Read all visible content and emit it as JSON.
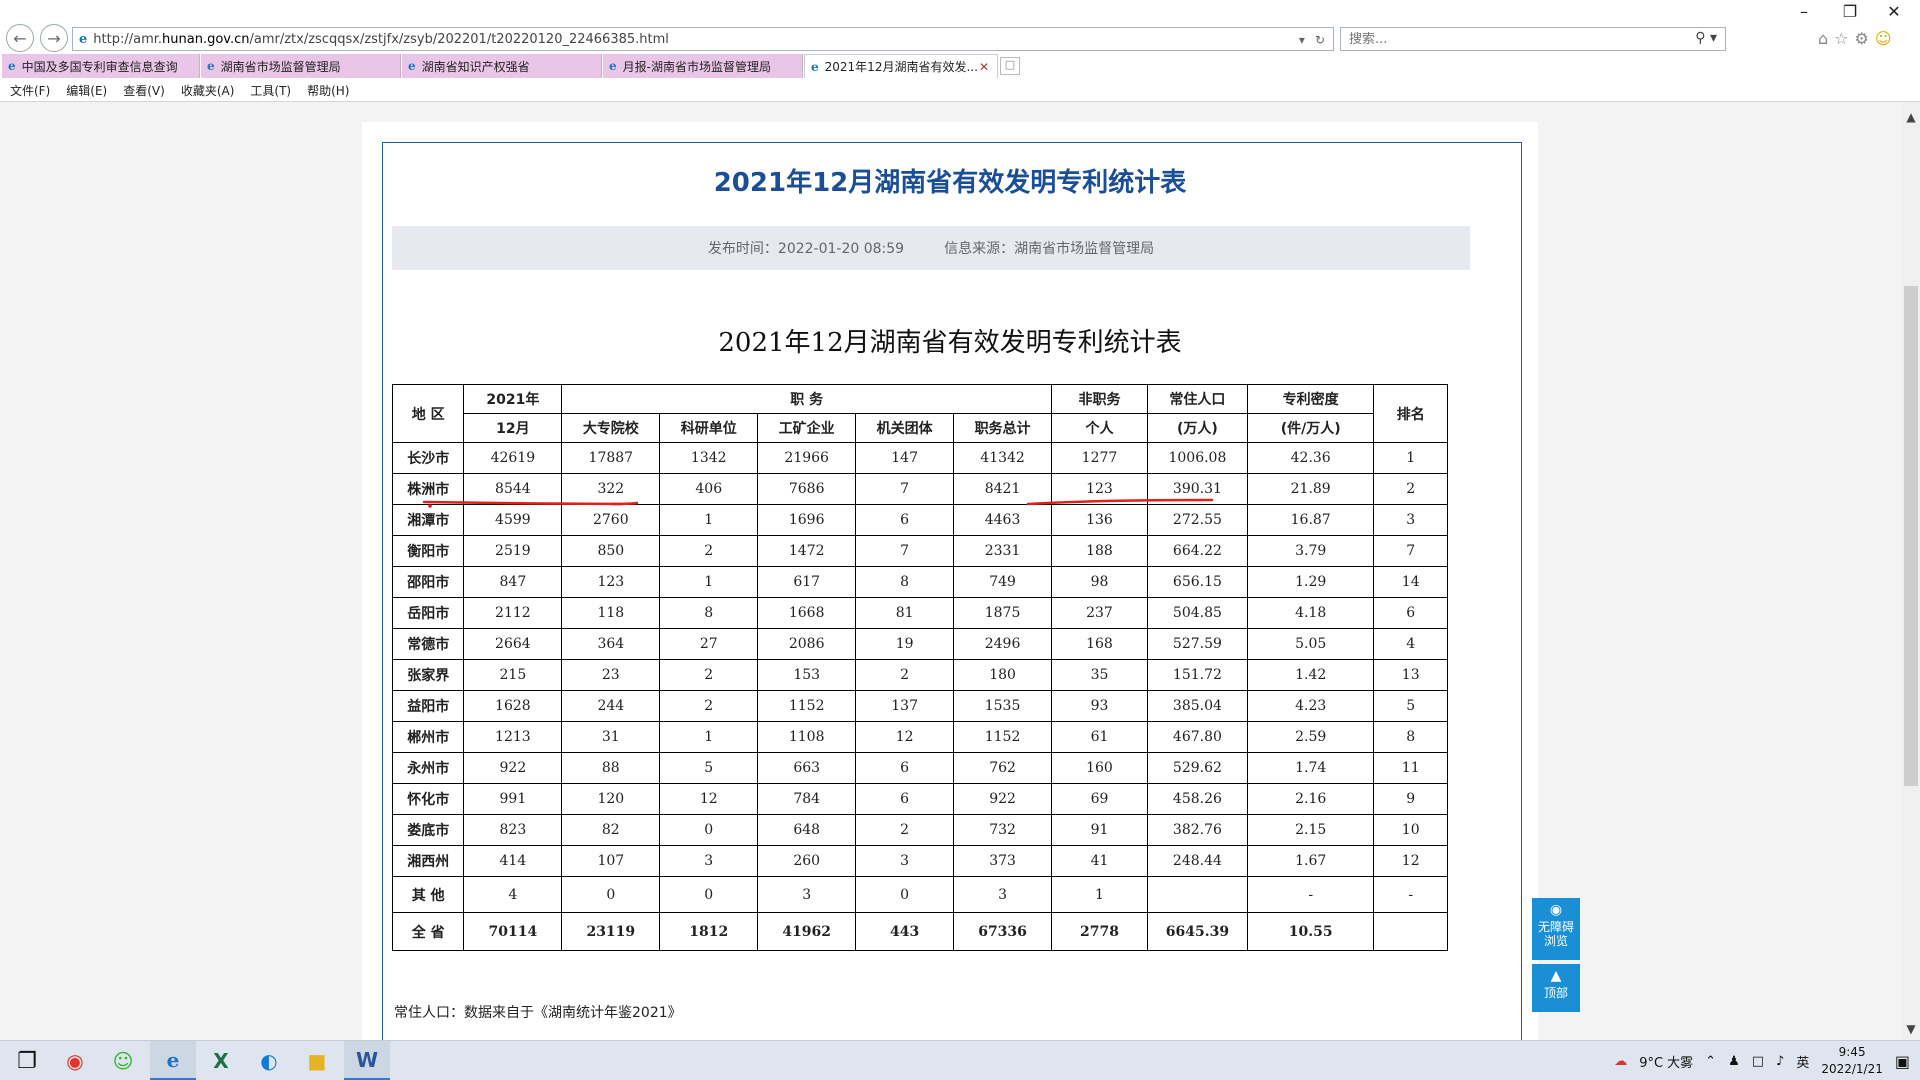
{
  "browser": {
    "url_prefix": "http://amr.",
    "url_host": "hunan.gov.cn",
    "url_path": "/amr/ztx/zscqqsx/zstjfx/zsyb/202201/t20220120_22466385.html",
    "search_placeholder": "搜索...",
    "tabs": [
      {
        "label": "中国及多国专利审查信息查询"
      },
      {
        "label": "湖南省市场监督管理局"
      },
      {
        "label": "湖南省知识产权强省"
      },
      {
        "label": "月报-湖南省市场监督管理局"
      },
      {
        "label": "2021年12月湖南省有效发..."
      }
    ],
    "menu": [
      "文件(F)",
      "编辑(E)",
      "查看(V)",
      "收藏夹(A)",
      "工具(T)",
      "帮助(H)"
    ]
  },
  "article": {
    "title": "2021年12月湖南省有效发明专利统计表",
    "publish_time": "发布时间：2022-01-20 08:59",
    "source": "信息来源：湖南省市场监督管理局",
    "table_title": "2021年12月湖南省有效发明专利统计表",
    "footnote": "常住人口：数据来自于《湖南统计年鉴2021》"
  },
  "table": {
    "headers": {
      "region": "地  区",
      "dec_line1": "2021年",
      "dec_line2": "12月",
      "service": "职  务",
      "universities": "大专院校",
      "research": "科研单位",
      "enterprises": "工矿企业",
      "institutions": "机关团体",
      "service_total": "职务总计",
      "nonservice_line1": "非职务",
      "nonservice_line2": "个人",
      "population_line1": "常住人口",
      "population_line2": "(万人)",
      "density_line1": "专利密度",
      "density_line2": "(件/万人)",
      "rank": "排名"
    },
    "rows": [
      [
        "长沙市",
        "42619",
        "17887",
        "1342",
        "21966",
        "147",
        "41342",
        "1277",
        "1006.08",
        "42.36",
        "1"
      ],
      [
        "株洲市",
        "8544",
        "322",
        "406",
        "7686",
        "7",
        "8421",
        "123",
        "390.31",
        "21.89",
        "2"
      ],
      [
        "湘潭市",
        "4599",
        "2760",
        "1",
        "1696",
        "6",
        "4463",
        "136",
        "272.55",
        "16.87",
        "3"
      ],
      [
        "衡阳市",
        "2519",
        "850",
        "2",
        "1472",
        "7",
        "2331",
        "188",
        "664.22",
        "3.79",
        "7"
      ],
      [
        "邵阳市",
        "847",
        "123",
        "1",
        "617",
        "8",
        "749",
        "98",
        "656.15",
        "1.29",
        "14"
      ],
      [
        "岳阳市",
        "2112",
        "118",
        "8",
        "1668",
        "81",
        "1875",
        "237",
        "504.85",
        "4.18",
        "6"
      ],
      [
        "常德市",
        "2664",
        "364",
        "27",
        "2086",
        "19",
        "2496",
        "168",
        "527.59",
        "5.05",
        "4"
      ],
      [
        "张家界",
        "215",
        "23",
        "2",
        "153",
        "2",
        "180",
        "35",
        "151.72",
        "1.42",
        "13"
      ],
      [
        "益阳市",
        "1628",
        "244",
        "2",
        "1152",
        "137",
        "1535",
        "93",
        "385.04",
        "4.23",
        "5"
      ],
      [
        "郴州市",
        "1213",
        "31",
        "1",
        "1108",
        "12",
        "1152",
        "61",
        "467.80",
        "2.59",
        "8"
      ],
      [
        "永州市",
        "922",
        "88",
        "5",
        "663",
        "6",
        "762",
        "160",
        "529.62",
        "1.74",
        "11"
      ],
      [
        "怀化市",
        "991",
        "120",
        "12",
        "784",
        "6",
        "922",
        "69",
        "458.26",
        "2.16",
        "9"
      ],
      [
        "娄底市",
        "823",
        "82",
        "0",
        "648",
        "2",
        "732",
        "91",
        "382.76",
        "2.15",
        "10"
      ],
      [
        "湘西州",
        "414",
        "107",
        "3",
        "260",
        "3",
        "373",
        "41",
        "248.44",
        "1.67",
        "12"
      ]
    ],
    "other": [
      "其  他",
      "4",
      "0",
      "0",
      "3",
      "0",
      "3",
      "1",
      "",
      "-",
      "-"
    ],
    "total": [
      "全  省",
      "70114",
      "23119",
      "1812",
      "41962",
      "443",
      "67336",
      "2778",
      "6645.39",
      "10.55",
      ""
    ]
  },
  "floating": {
    "access_line1": "无障碍",
    "access_line2": "浏览",
    "top_label": "顶部"
  },
  "taskbar": {
    "weather": "9°C  大雾",
    "ime": "英",
    "time": "9:45",
    "date": "2022/1/21"
  },
  "colors": {
    "title_blue": "#1a4f98",
    "frame_blue": "#1f5aa0",
    "annotation_red": "#e0201c",
    "float_blue": "#1a8fd6"
  }
}
